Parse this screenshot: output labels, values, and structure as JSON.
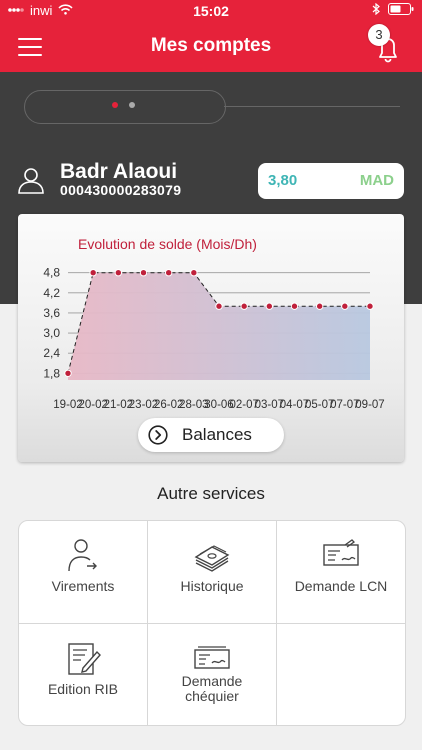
{
  "status_bar": {
    "carrier": "inwi",
    "time": "15:02"
  },
  "header": {
    "title": "Mes comptes",
    "notification_count": "3"
  },
  "account": {
    "name": "Badr Alaoui",
    "number": "000430000283079",
    "balance": "3,80",
    "currency": "MAD"
  },
  "chart_data": {
    "type": "area",
    "title": "Evolution de solde (Mois/Dh)",
    "xlabel": "",
    "ylabel": "",
    "ylim": [
      1.6,
      5.0
    ],
    "yticks": [
      "1,8",
      "2,4",
      "3,0",
      "3,6",
      "4,2",
      "4,8"
    ],
    "x": [
      "19-02",
      "20-02",
      "21-02",
      "23-02",
      "26-02",
      "28-03",
      "30-06",
      "02-07",
      "03-07",
      "04-07",
      "05-07",
      "07-07",
      "09-07"
    ],
    "series": [
      {
        "values": [
          1.8,
          4.8,
          4.8,
          4.8,
          4.8,
          4.8,
          3.8,
          3.8,
          3.8,
          3.8,
          3.8,
          3.8,
          3.8
        ]
      }
    ],
    "grid": true,
    "colors": {
      "area_top": "#e8b8c6",
      "area_bottom": "#b8c8e0",
      "line": "#222222",
      "point": "#c0203b"
    }
  },
  "chart_button": {
    "label": "Balances"
  },
  "services": {
    "title": "Autre services",
    "items": [
      {
        "label": "Virements",
        "icon": "person-transfer-icon"
      },
      {
        "label": "Historique",
        "icon": "banknotes-icon"
      },
      {
        "label": "Demande LCN",
        "icon": "cheque-icon"
      },
      {
        "label": "Edition RIB",
        "icon": "document-edit-icon"
      },
      {
        "label": "Demande chéquier",
        "icon": "chequebook-icon"
      }
    ]
  }
}
